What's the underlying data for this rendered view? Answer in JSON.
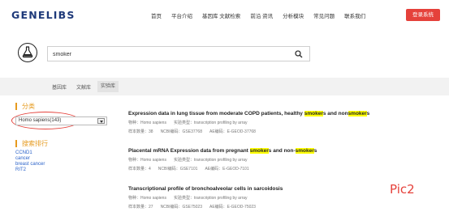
{
  "header": {
    "logo": "GENELIBS",
    "nav": [
      "首页",
      "平台介绍",
      "基因库 文献检索",
      "前沿 资讯",
      "分析模块",
      "常见问题",
      "联系我们"
    ],
    "login_button": "登录系统"
  },
  "search": {
    "value": "smoker",
    "icon": "search-icon"
  },
  "tabs": [
    "基因库",
    "文献库",
    "实验库"
  ],
  "active_tab": 2,
  "sidebar": {
    "classification_title": "分类",
    "species_select_value": "Homo sapiens(143)",
    "ranking_title": "搜索排行",
    "ranking_items": [
      "CCND1",
      "cancer",
      "breast cancer",
      "RIT2"
    ]
  },
  "results": [
    {
      "title_parts": [
        "Expression data in lung tissue from moderate COPD patients, healthy ",
        "smoker",
        "s and non",
        "smoker",
        "s"
      ],
      "species": "物种：Homo sapiens",
      "type": "实验类型：transcription profiling by array",
      "samples": "样本数量：38",
      "ncbi": "NCBI编码：GSE37768",
      "ae": "AE编码：E-GEOD-37768"
    },
    {
      "title_parts": [
        "Placental mRNA Expression data from pregnant ",
        "smoker",
        "s and non-",
        "smoker",
        "s"
      ],
      "species": "物种：Homo sapiens",
      "type": "实验类型：transcription profiling by array",
      "samples": "样本数量：4",
      "ncbi": "NCBI编码：GSE7101",
      "ae": "AE编码：E-GEOD-7101"
    },
    {
      "title_parts": [
        "Transcriptional profile of bronchoalveolar cells in sarcoidosis"
      ],
      "species": "物种：Homo sapiens",
      "type": "实验类型：transcription profiling by array",
      "samples": "样本数量：27",
      "ncbi": "NCBI编码：GSE75023",
      "ae": "AE编码：E-GEOD-75023"
    }
  ],
  "annotation": "Pic2",
  "colors": {
    "accent_orange": "#e69a1e",
    "login_red": "#e5413b",
    "link_blue": "#2a62c9",
    "highlight": "#ffff00",
    "logo_blue": "#1f3a7a"
  }
}
